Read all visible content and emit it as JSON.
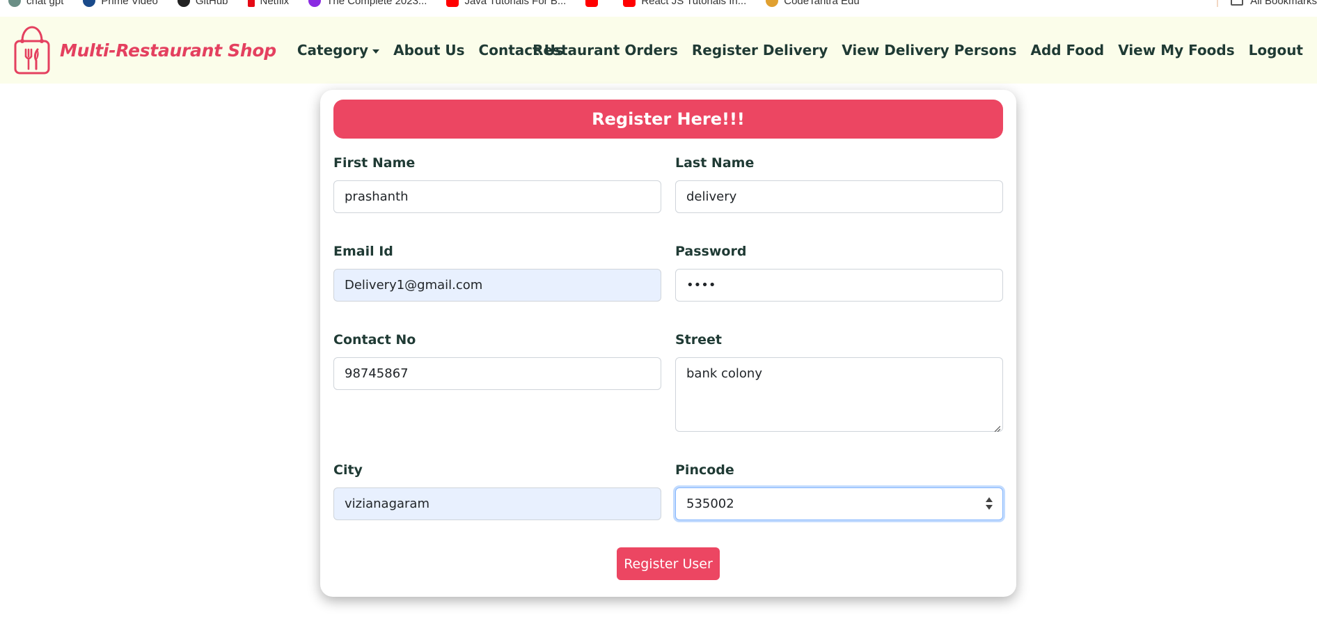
{
  "bookmarks": {
    "items": [
      {
        "label": "chat gpt",
        "icon": "chatgpt-icon",
        "color": "#6b8f86"
      },
      {
        "label": "Prime Video",
        "icon": "prime-video-icon",
        "color": "#1a4a8a"
      },
      {
        "label": "GitHub",
        "icon": "github-icon",
        "color": "#222222"
      },
      {
        "label": "Netflix",
        "icon": "netflix-icon",
        "color": "#e50914"
      },
      {
        "label": "The Complete 2023...",
        "icon": "course-icon",
        "color": "#8a2be2"
      },
      {
        "label": "Java Tutorials For B...",
        "icon": "youtube-icon",
        "color": "#ff0000"
      },
      {
        "label": "",
        "icon": "youtube-icon",
        "color": "#ff0000"
      },
      {
        "label": "React JS Tutorials In...",
        "icon": "youtube-icon",
        "color": "#ff0000"
      },
      {
        "label": "CodeTantra Edu",
        "icon": "codetantra-icon",
        "color": "#e0a030"
      }
    ],
    "all_bookmarks": "All Bookmarks"
  },
  "navbar": {
    "brand": "Multi-Restaurant Shop",
    "left_links": [
      "Category",
      "About Us",
      "Contact Us"
    ],
    "right_links": [
      "Restaurant Orders",
      "Register Delivery",
      "View Delivery Persons",
      "Add Food",
      "View My Foods",
      "Logout"
    ]
  },
  "form": {
    "title": "Register Here!!!",
    "first_name": {
      "label": "First Name",
      "value": "prashanth"
    },
    "last_name": {
      "label": "Last Name",
      "value": "delivery"
    },
    "email": {
      "label": "Email Id",
      "value": "Delivery1@gmail.com"
    },
    "password": {
      "label": "Password",
      "value": "1234"
    },
    "contact": {
      "label": "Contact No",
      "value": "98745867"
    },
    "street": {
      "label": "Street",
      "value": "bank colony"
    },
    "city": {
      "label": "City",
      "value": "vizianagaram"
    },
    "pincode": {
      "label": "Pincode",
      "value": "535002"
    },
    "submit_label": "Register User"
  },
  "colors": {
    "accent": "#ec4662",
    "navbar_bg": "#fbfdea",
    "text": "#1f3a34",
    "autofill_bg": "#e8f0fe"
  }
}
